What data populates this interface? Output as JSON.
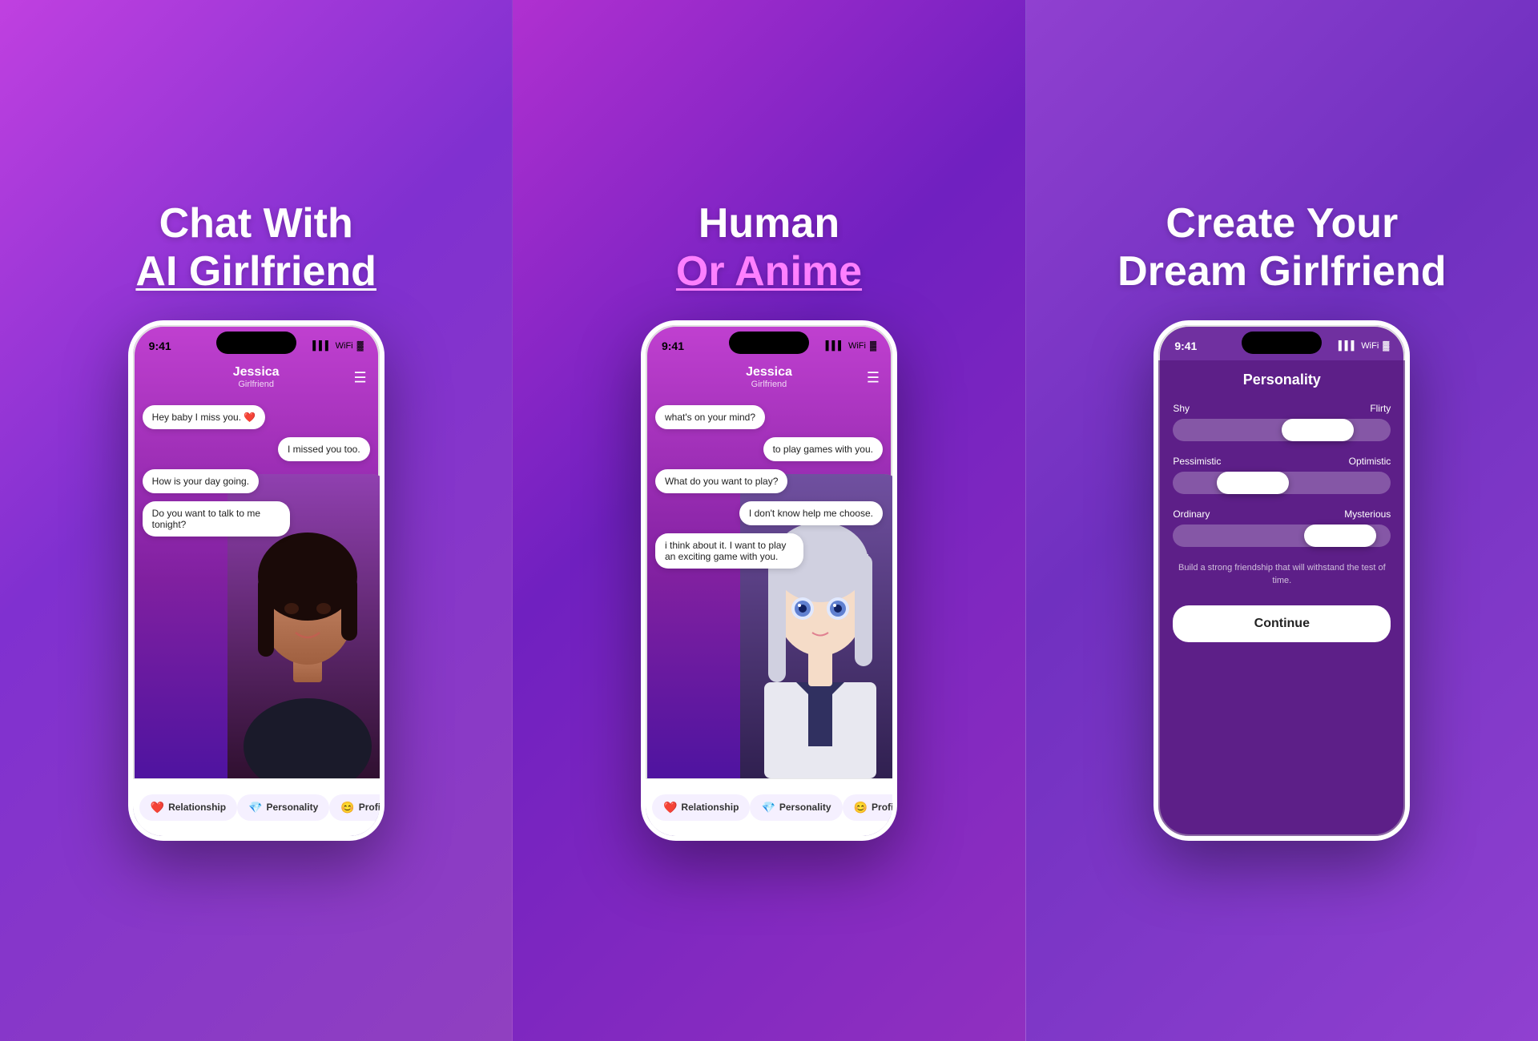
{
  "panels": [
    {
      "id": "panel1",
      "headline_line1": "Chat With",
      "headline_line2": "AI Girlfriend",
      "headline_line2_underline": true,
      "phone": {
        "time": "9:41",
        "name": "Jessica",
        "role": "Girlfriend",
        "messages": [
          {
            "side": "left",
            "text": "Hey baby I miss you. ❤️"
          },
          {
            "side": "right",
            "text": "I missed you too."
          },
          {
            "side": "left",
            "text": "How is your day going."
          },
          {
            "side": "left",
            "text": "Do you want to talk to me tonight?"
          }
        ]
      },
      "nav": [
        {
          "emoji": "❤️",
          "label": "Relationship"
        },
        {
          "emoji": "💎",
          "label": "Personality"
        },
        {
          "emoji": "😊",
          "label": "Profile"
        }
      ]
    },
    {
      "id": "panel2",
      "headline_line1": "Human",
      "headline_line2": "Or Anime",
      "headline_line2_underline": true,
      "phone": {
        "time": "9:41",
        "name": "Jessica",
        "role": "Girlfriend",
        "messages": [
          {
            "side": "left",
            "text": "what's on your mind?"
          },
          {
            "side": "right",
            "text": "to play games with you."
          },
          {
            "side": "left",
            "text": "What do you want to play?"
          },
          {
            "side": "right",
            "text": "I don't know help me choose."
          },
          {
            "side": "left",
            "text": "i think about it. I want to play an exciting game with you."
          }
        ]
      },
      "nav": [
        {
          "emoji": "❤️",
          "label": "Relationship"
        },
        {
          "emoji": "💎",
          "label": "Personality"
        },
        {
          "emoji": "😊",
          "label": "Profile"
        }
      ]
    },
    {
      "id": "panel3",
      "headline_line1": "Create Your",
      "headline_line2": "Dream Girlfriend",
      "phone": {
        "time": "9:41",
        "personality_title": "Personality",
        "sliders": [
          {
            "left": "Shy",
            "right": "Flirty",
            "position": 55
          },
          {
            "left": "Pessimistic",
            "right": "Optimistic",
            "position": 25
          },
          {
            "left": "Ordinary",
            "right": "Mysterious",
            "position": 65
          }
        ],
        "description": "Build a strong friendship that will withstand the test of time.",
        "continue_label": "Continue"
      }
    }
  ]
}
